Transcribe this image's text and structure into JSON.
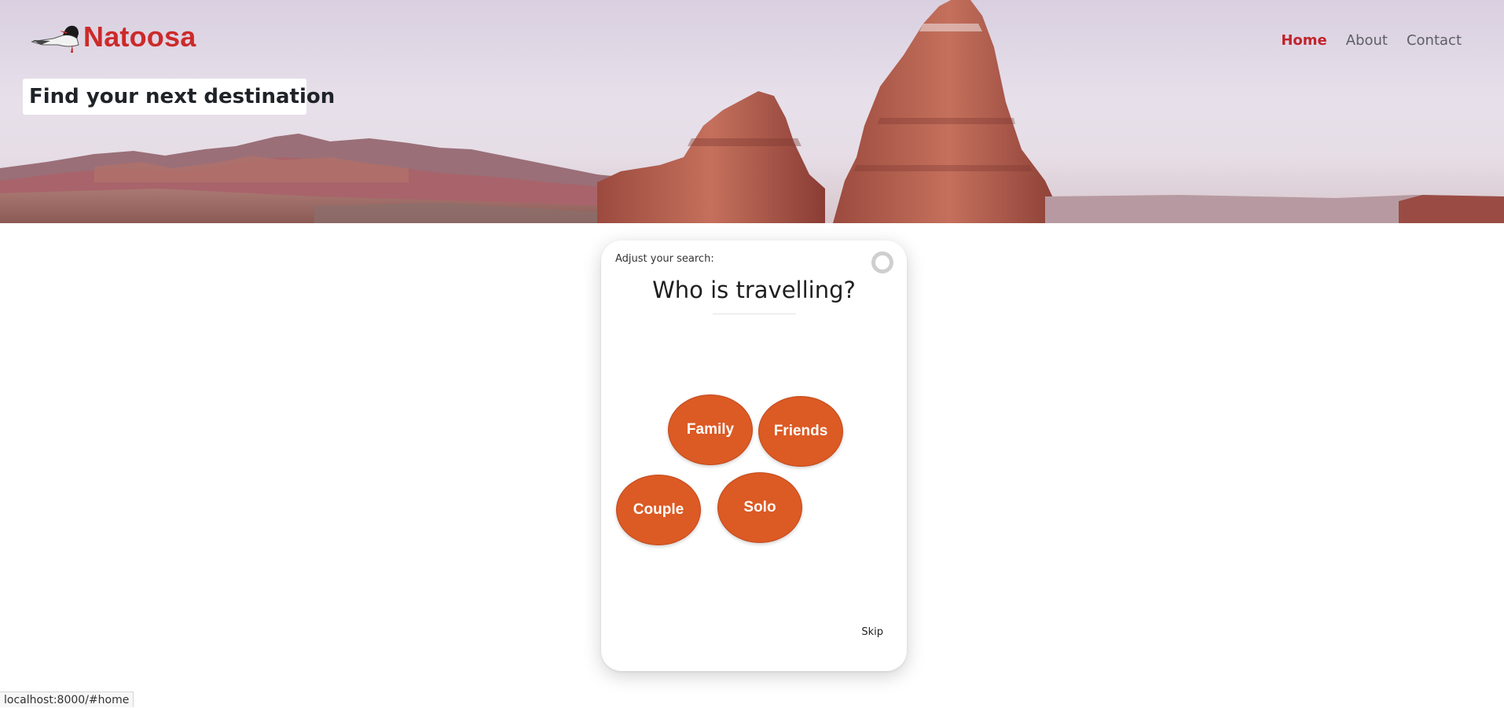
{
  "brand": {
    "name": "Natoosa",
    "color": "#cc2a2a",
    "icon": "bird-icon"
  },
  "nav": {
    "items": [
      {
        "label": "Home",
        "active": true
      },
      {
        "label": "About",
        "active": false
      },
      {
        "label": "Contact",
        "active": false
      }
    ]
  },
  "hero": {
    "title": "Find your next destination",
    "image": "canyon-landscape"
  },
  "card": {
    "label": "Adjust your search:",
    "question": "Who is travelling?",
    "options": [
      "Family",
      "Friends",
      "Couple",
      "Solo"
    ],
    "option_color": "#dc5a24",
    "skip_label": "Skip",
    "close_icon": "circle-close-icon"
  },
  "status_bar": {
    "url": "localhost:8000/#home"
  }
}
